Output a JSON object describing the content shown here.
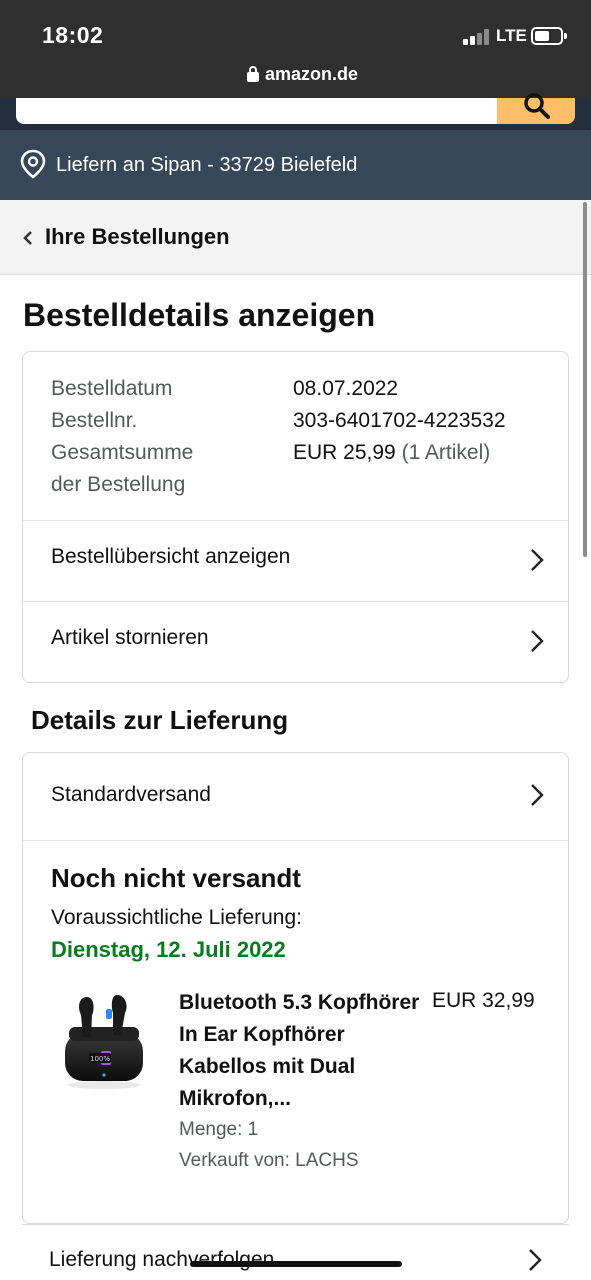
{
  "status_bar": {
    "time": "18:02",
    "network": "LTE"
  },
  "browser": {
    "url": "amazon.de"
  },
  "header": {
    "deliver_to": "Liefern an Sipan - 33729 Bielefeld"
  },
  "breadcrumb": {
    "back_label": "Ihre Bestellungen"
  },
  "page": {
    "title": "Bestelldetails anzeigen"
  },
  "order_summary": {
    "rows": [
      {
        "label": "Bestelldatum",
        "value": "08.07.2022"
      },
      {
        "label": "Bestellnr.",
        "value": "303-6401702-4223532"
      },
      {
        "label_line1": "Gesamtsumme",
        "label_line2": "der Bestellung",
        "value": "EUR 25,99",
        "value_note": "(1 Artikel)"
      }
    ],
    "links": [
      {
        "label": "Bestellübersicht anzeigen"
      },
      {
        "label": "Artikel stornieren"
      }
    ]
  },
  "delivery": {
    "section_title": "Details zur Lieferung",
    "shipping_method": "Standardversand",
    "status": "Noch nicht versandt",
    "eta_label": "Voraussichtliche Lieferung:",
    "eta_date": "Dienstag, 12. Juli 2022",
    "eta_color": "#0a7c1c",
    "item": {
      "title": "Bluetooth 5.3 Kopfhörer In Ear Kopfhörer Kabellos mit Dual Mikrofon,...",
      "price": "EUR 32,99",
      "quantity": "Menge: 1",
      "seller": "Verkauft von: LACHS",
      "case_display": "100%"
    },
    "track_label": "Lieferung nachverfolgen"
  },
  "colors": {
    "status_bar": "#2f2f2f",
    "amazon_header": "#232f3e",
    "deliver_bar": "#37475a",
    "search_button": "#febd69"
  }
}
